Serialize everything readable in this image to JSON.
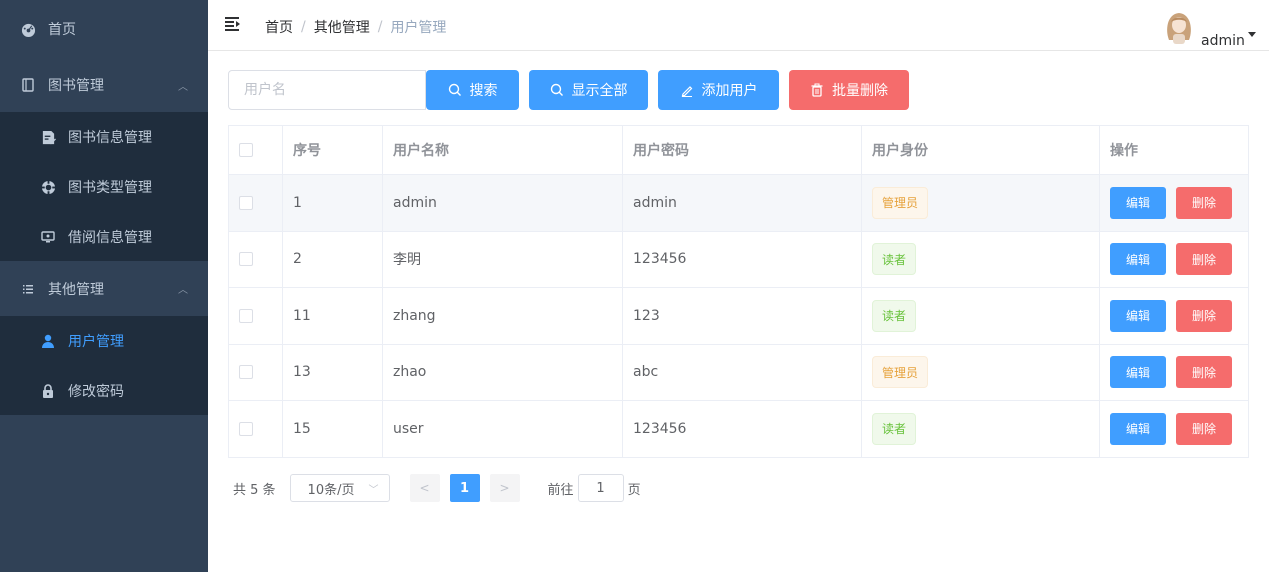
{
  "sidebar": {
    "items": [
      {
        "label": "首页",
        "icon": "dashboard-icon"
      },
      {
        "label": "图书管理",
        "icon": "book-icon",
        "expanded": true
      },
      {
        "label": "图书信息管理",
        "icon": "document-edit-icon"
      },
      {
        "label": "图书类型管理",
        "icon": "lifebuoy-icon"
      },
      {
        "label": "借阅信息管理",
        "icon": "monitor-icon"
      },
      {
        "label": "其他管理",
        "icon": "list-icon",
        "expanded": true
      },
      {
        "label": "用户管理",
        "icon": "user-icon",
        "active": true
      },
      {
        "label": "修改密码",
        "icon": "lock-icon"
      }
    ]
  },
  "header": {
    "breadcrumb": [
      "首页",
      "其他管理",
      "用户管理"
    ],
    "username": "admin"
  },
  "toolbar": {
    "search_placeholder": "用户名",
    "search_label": "搜索",
    "show_all_label": "显示全部",
    "add_user_label": "添加用户",
    "batch_delete_label": "批量删除"
  },
  "table": {
    "columns": [
      "序号",
      "用户名称",
      "用户密码",
      "用户身份",
      "操作"
    ],
    "rows": [
      {
        "id": "1",
        "name": "admin",
        "password": "admin",
        "role": "管理员"
      },
      {
        "id": "2",
        "name": "李明",
        "password": "123456",
        "role": "读者"
      },
      {
        "id": "11",
        "name": "zhang",
        "password": "123",
        "role": "读者"
      },
      {
        "id": "13",
        "name": "zhao",
        "password": "abc",
        "role": "管理员"
      },
      {
        "id": "15",
        "name": "user",
        "password": "123456",
        "role": "读者"
      }
    ],
    "edit_label": "编辑",
    "delete_label": "删除"
  },
  "pagination": {
    "total": "共 5 条",
    "page_size": "10条/页",
    "current_page": "1",
    "goto_label": "前往",
    "goto_value": "1",
    "page_suffix": "页"
  },
  "colors": {
    "sidebar_bg": "#304156",
    "submenu_bg": "#1f2d3d",
    "primary": "#409eff",
    "danger": "#f56c6c"
  }
}
